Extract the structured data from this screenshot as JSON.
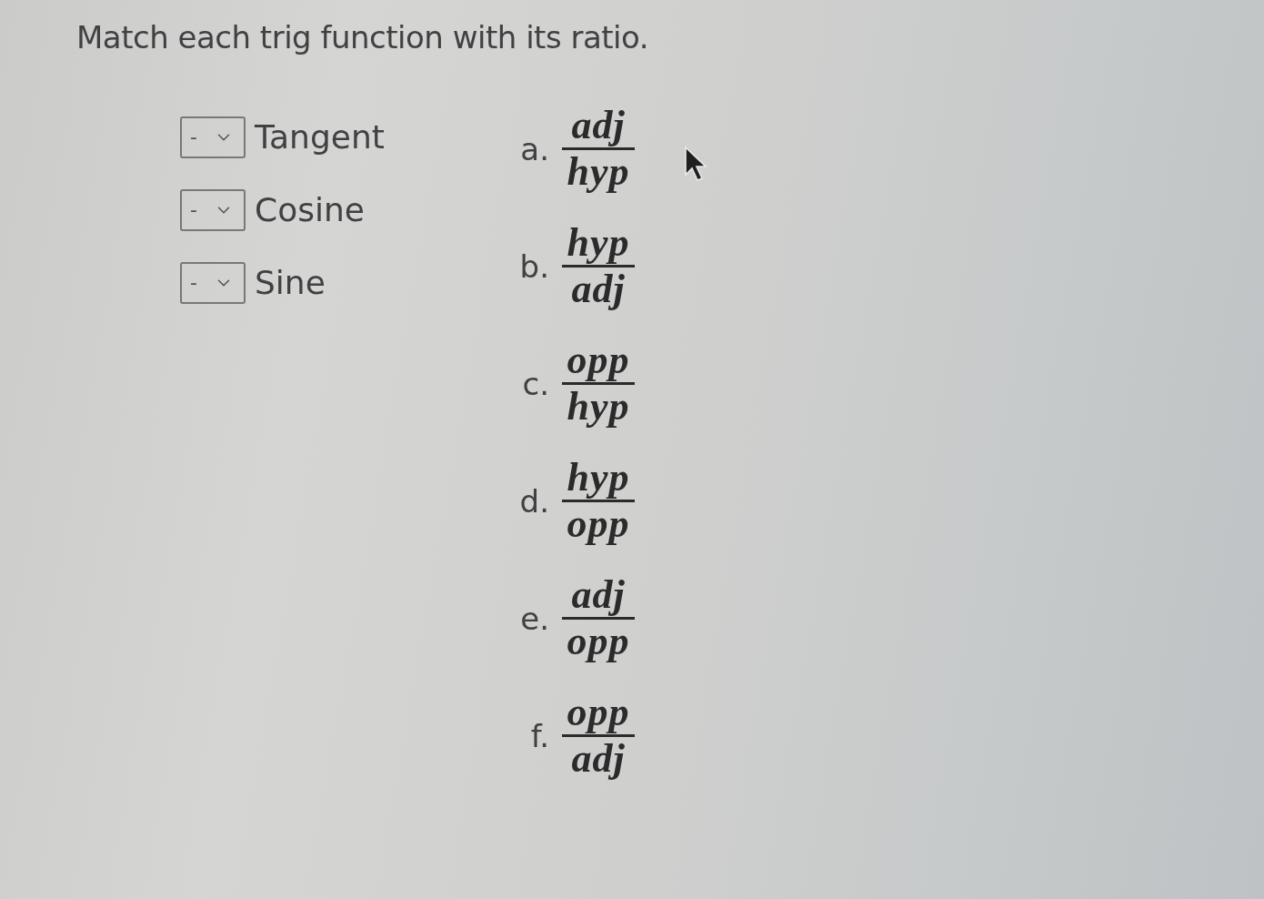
{
  "prompt": {
    "text": "Match each trig function with its ratio."
  },
  "functions": [
    {
      "label": "Tangent",
      "dropdown": {
        "value": "-"
      }
    },
    {
      "label": "Cosine",
      "dropdown": {
        "value": "-"
      }
    },
    {
      "label": "Sine",
      "dropdown": {
        "value": "-"
      }
    }
  ],
  "ratios": [
    {
      "letter": "a.",
      "numerator": "adj",
      "denominator": "hyp"
    },
    {
      "letter": "b.",
      "numerator": "hyp",
      "denominator": "adj"
    },
    {
      "letter": "c.",
      "numerator": "opp",
      "denominator": "hyp"
    },
    {
      "letter": "d.",
      "numerator": "hyp",
      "denominator": "opp"
    },
    {
      "letter": "e.",
      "numerator": "adj",
      "denominator": "opp"
    },
    {
      "letter": "f.",
      "numerator": "opp",
      "denominator": "adj"
    }
  ]
}
